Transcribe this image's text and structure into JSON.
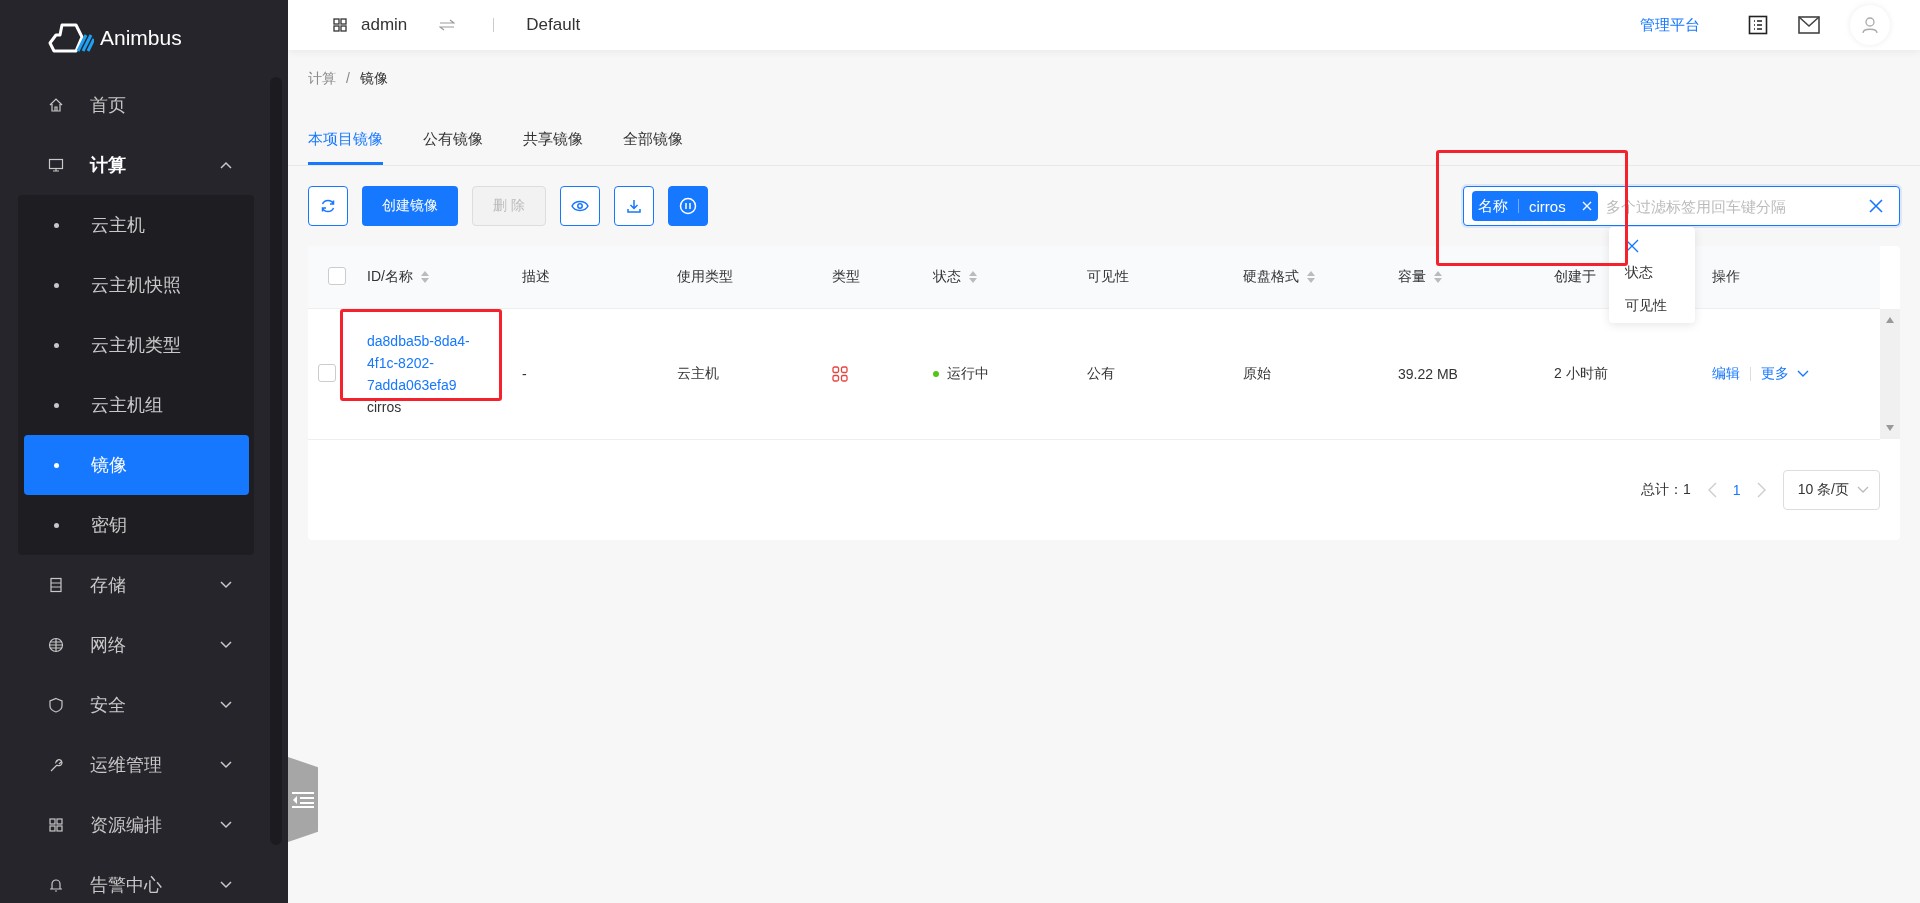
{
  "brand": {
    "name": "Animbus"
  },
  "header": {
    "project": "admin",
    "domain": "Default",
    "admin_link": "管理平台"
  },
  "sidebar": {
    "items": [
      {
        "label": "首页",
        "selected": false
      },
      {
        "label": "计算",
        "selected": false,
        "expanded": true,
        "children": [
          {
            "label": "云主机",
            "selected": false
          },
          {
            "label": "云主机快照",
            "selected": false
          },
          {
            "label": "云主机类型",
            "selected": false
          },
          {
            "label": "云主机组",
            "selected": false
          },
          {
            "label": "镜像",
            "selected": true
          },
          {
            "label": "密钥",
            "selected": false
          }
        ]
      },
      {
        "label": "存储",
        "selected": false,
        "expanded": false
      },
      {
        "label": "网络",
        "selected": false,
        "expanded": false
      },
      {
        "label": "安全",
        "selected": false,
        "expanded": false
      },
      {
        "label": "运维管理",
        "selected": false,
        "expanded": false
      },
      {
        "label": "资源编排",
        "selected": false,
        "expanded": false
      },
      {
        "label": "告警中心",
        "selected": false,
        "expanded": false
      }
    ]
  },
  "breadcrumb": {
    "items": [
      "计算",
      "镜像"
    ],
    "separator": "/"
  },
  "tabs": [
    {
      "label": "本项目镜像",
      "selected": true
    },
    {
      "label": "公有镜像",
      "selected": false
    },
    {
      "label": "共享镜像",
      "selected": false
    },
    {
      "label": "全部镜像",
      "selected": false
    }
  ],
  "toolbar": {
    "create": "创建镜像",
    "delete": "删 除",
    "delete_disabled": true
  },
  "filter": {
    "tag_key": "名称",
    "tag_value": "cirros",
    "placeholder": "多个过滤标签用回车键分隔",
    "menu": [
      "状态",
      "可见性"
    ]
  },
  "table": {
    "all_checked": false,
    "columns": [
      {
        "label": "ID/名称",
        "sortable": true
      },
      {
        "label": "描述",
        "sortable": false
      },
      {
        "label": "使用类型",
        "sortable": false
      },
      {
        "label": "类型",
        "sortable": false
      },
      {
        "label": "状态",
        "sortable": true
      },
      {
        "label": "可见性",
        "sortable": false
      },
      {
        "label": "硬盘格式",
        "sortable": true
      },
      {
        "label": "容量",
        "sortable": true
      },
      {
        "label": "创建于",
        "sortable": false
      },
      {
        "label": "操作",
        "sortable": false
      }
    ],
    "rows": [
      {
        "checked": false,
        "id": "da8dba5b-8da4-4f1c-8202-7adda063efa9",
        "name": "cirros",
        "description": "-",
        "usage": "云主机",
        "status": {
          "text": "运行中",
          "color": "#52c41a"
        },
        "visibility": "公有",
        "format": "原始",
        "size": "39.22 MB",
        "created": "2 小时前",
        "actions": [
          "编辑",
          "更多"
        ]
      }
    ]
  },
  "pagination": {
    "total_label": "总计：",
    "total": "1",
    "page": "1",
    "page_size": "10 条/页"
  }
}
